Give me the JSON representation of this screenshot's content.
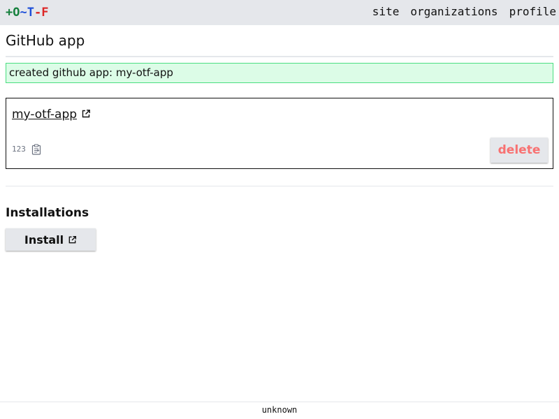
{
  "header": {
    "logo": {
      "parts": [
        {
          "text": "+O",
          "color": "#15803d"
        },
        {
          "text": "~T",
          "color": "#1d4ed8"
        },
        {
          "text": "-F",
          "color": "#dc2626"
        }
      ]
    },
    "nav": {
      "site": "site",
      "organizations": "organizations",
      "profile": "profile"
    }
  },
  "page": {
    "title": "GitHub app"
  },
  "flash": {
    "message": "created github app: my-otf-app",
    "background": "#dcfce7",
    "border": "#4ade80"
  },
  "app": {
    "name": "my-otf-app",
    "link_icon": "external-link-icon",
    "id": "123",
    "copy_icon": "clipboard-icon",
    "delete_label": "delete",
    "delete_color": "#f87171"
  },
  "installations": {
    "heading": "Installations",
    "install_label": "Install",
    "install_icon": "external-link-icon"
  },
  "footer": {
    "version": "unknown"
  }
}
